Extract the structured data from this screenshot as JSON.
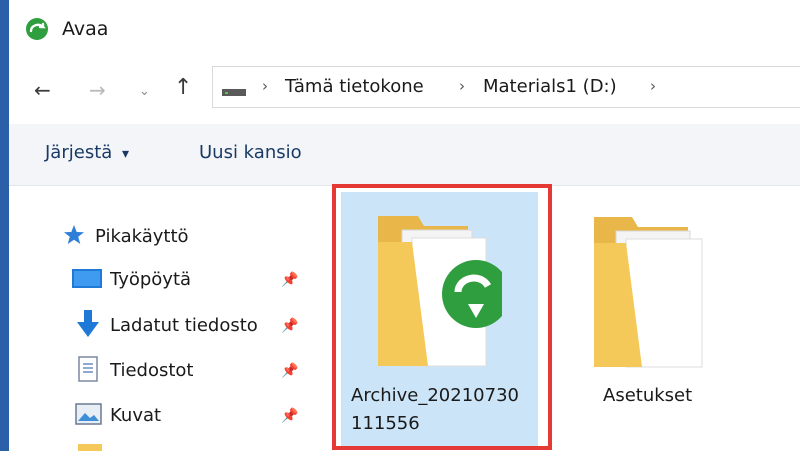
{
  "window": {
    "title": "Avaa"
  },
  "nav": {
    "back_icon": "arrow-left-icon",
    "forward_icon": "arrow-right-icon",
    "recent_icon": "chevron-down-icon",
    "up_icon": "arrow-up-icon"
  },
  "breadcrumb": {
    "items": [
      "Tämä tietokone",
      "Materials1 (D:)"
    ],
    "separator": "›"
  },
  "toolbar": {
    "organize_label": "Järjestä",
    "organize_arrow": "▾",
    "new_folder_label": "Uusi kansio"
  },
  "sidebar": {
    "items": [
      {
        "label": "Pikakäyttö",
        "icon": "star-icon"
      },
      {
        "label": "Työpöytä",
        "icon": "desktop-icon",
        "pinned": true
      },
      {
        "label": "Ladatut tiedosto",
        "icon": "download-icon",
        "pinned": true
      },
      {
        "label": "Tiedostot",
        "icon": "document-icon",
        "pinned": true
      },
      {
        "label": "Kuvat",
        "icon": "pictures-icon",
        "pinned": true
      }
    ]
  },
  "files": [
    {
      "label_line1": "Archive_20210730",
      "label_line2": "111556",
      "icon": "folder-archive-icon",
      "selected": true
    },
    {
      "label_line1": "Asetukset",
      "icon": "folder-icon",
      "selected": false
    }
  ],
  "colors": {
    "selection_bg": "#cce4f7",
    "highlight_border": "#e53935",
    "folder_yellow": "#f5c85a",
    "accent_green": "#2e9e3e"
  }
}
